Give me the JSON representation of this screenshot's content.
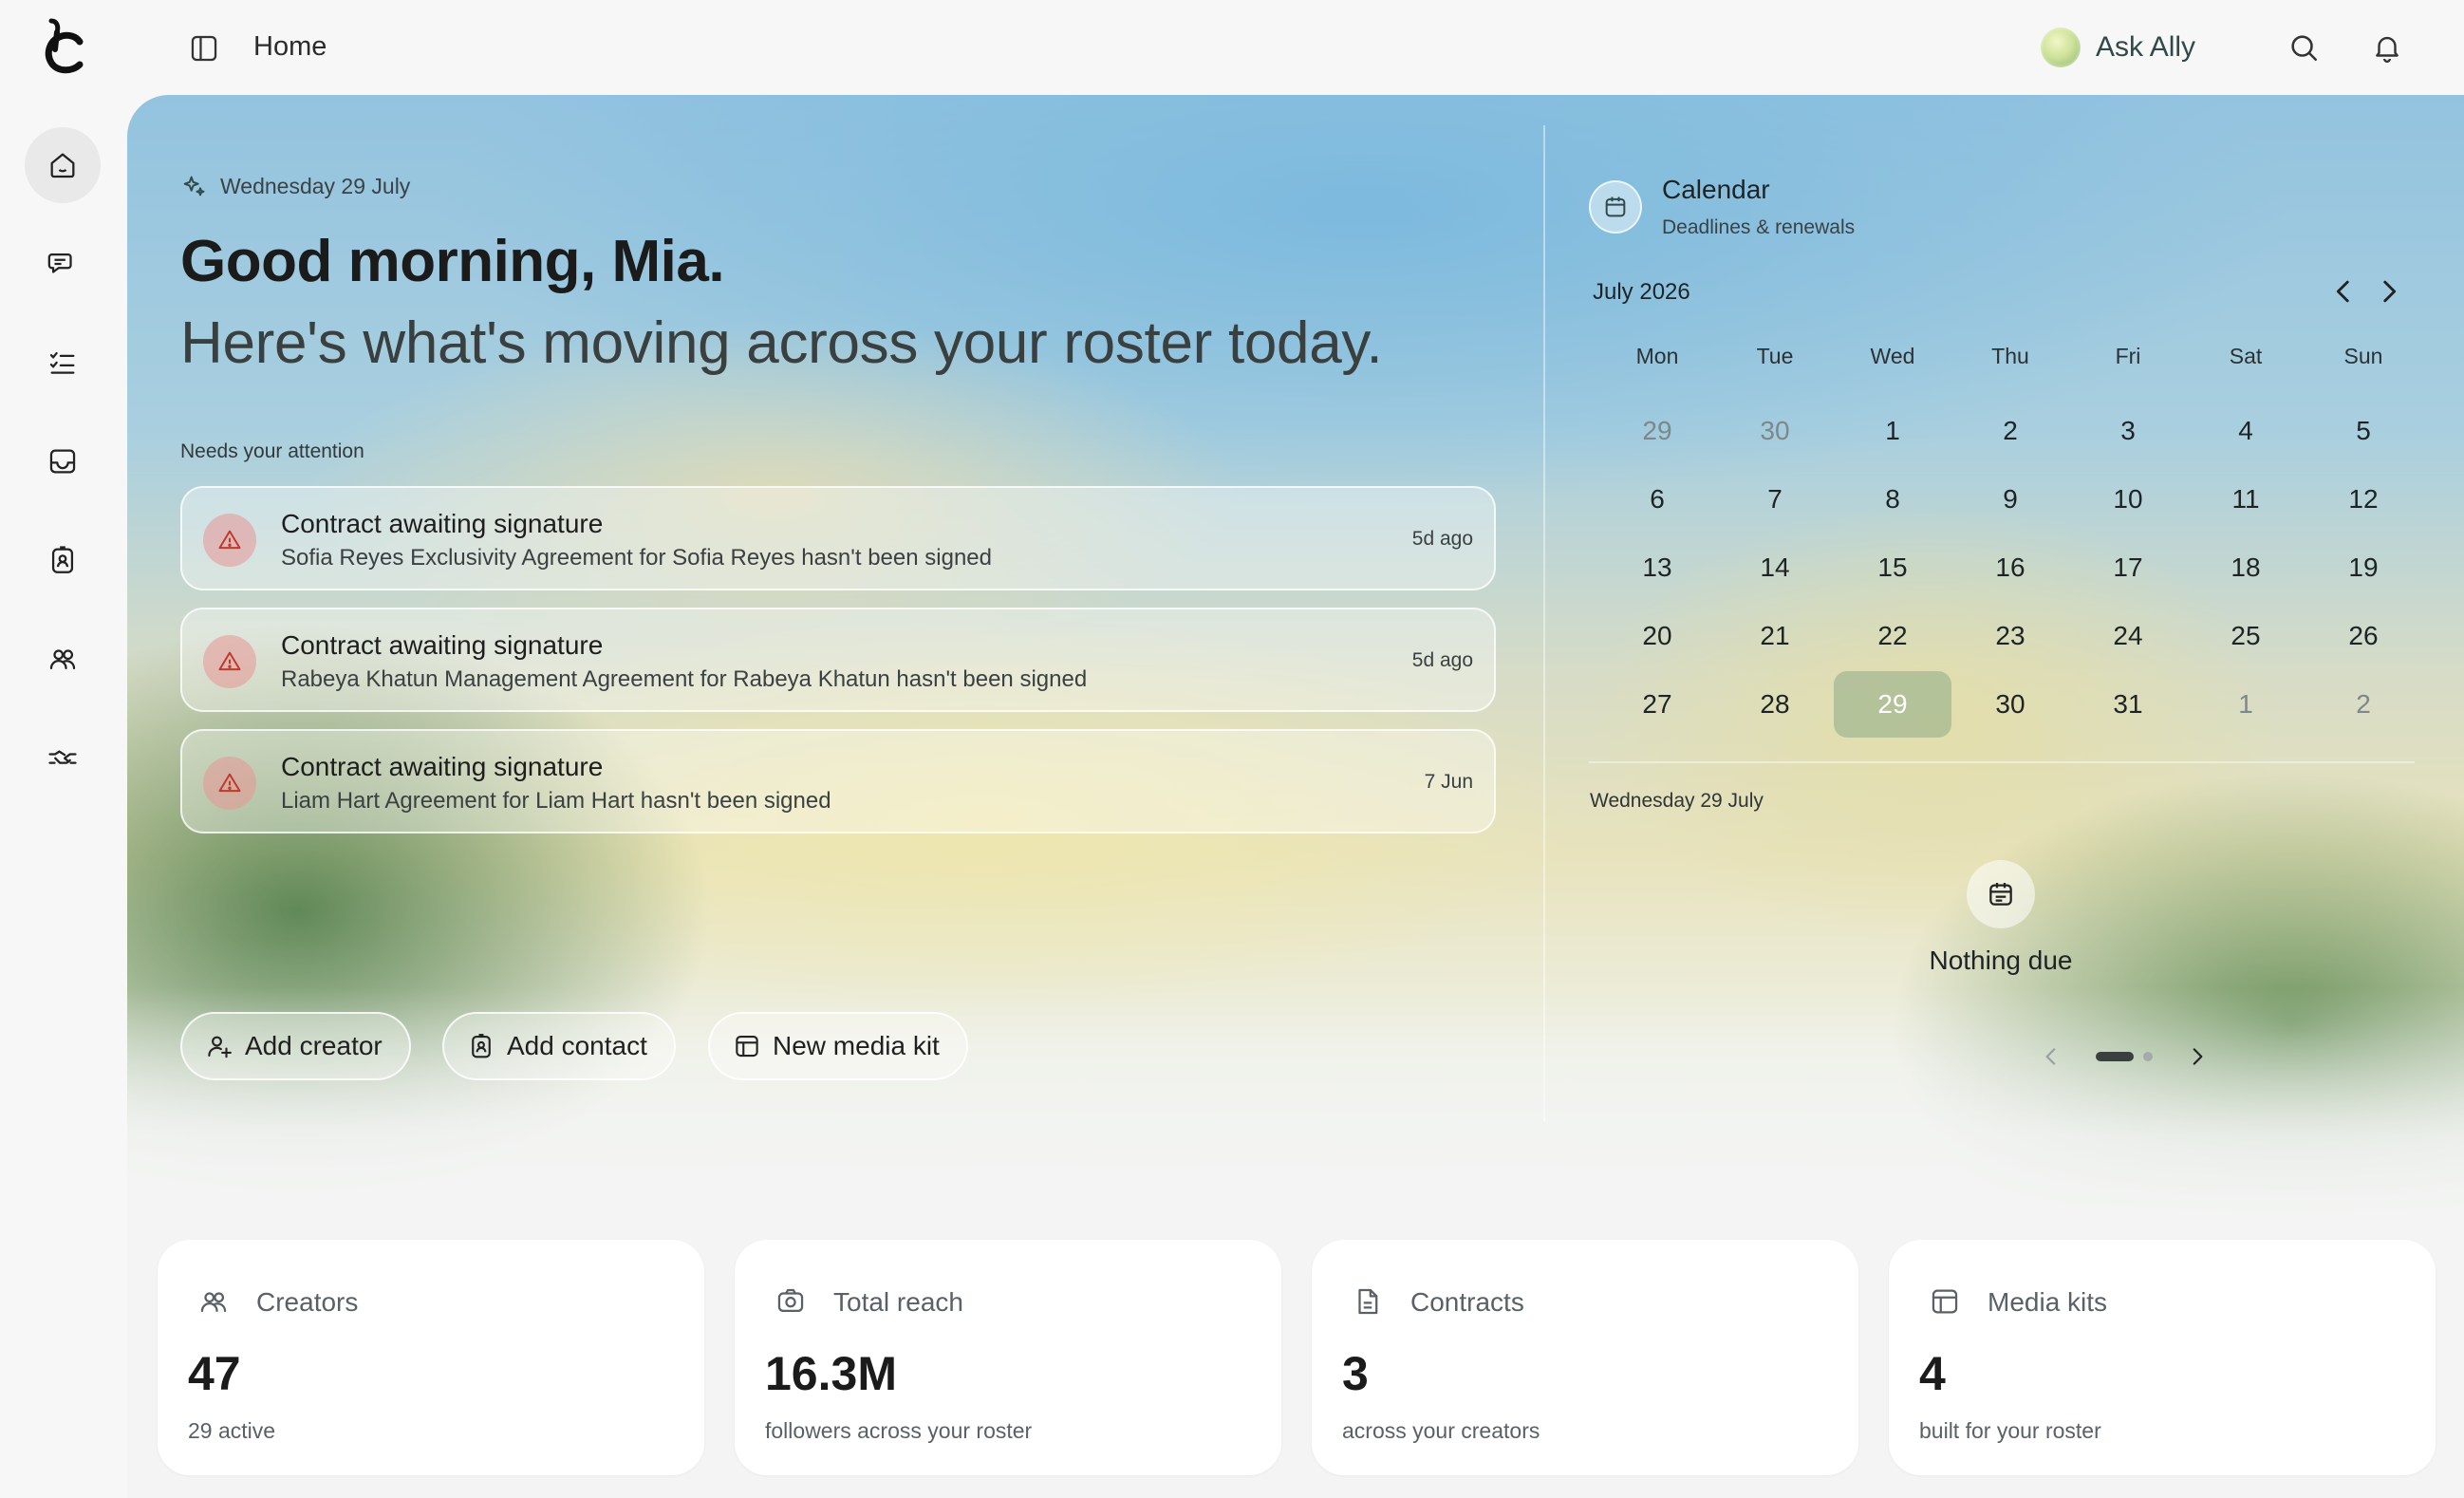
{
  "header": {
    "title": "Home",
    "ask_label": "Ask Ally"
  },
  "greeting": {
    "date": "Wednesday 29 July",
    "headline": "Good morning, Mia.",
    "subline": "Here's what's moving across your roster today."
  },
  "attention": {
    "heading": "Needs your attention",
    "items": [
      {
        "title": "Contract awaiting signature",
        "desc": "Sofia Reyes Exclusivity Agreement for Sofia Reyes hasn't been signed",
        "time": "5d ago"
      },
      {
        "title": "Contract awaiting signature",
        "desc": "Rabeya Khatun Management Agreement for Rabeya Khatun hasn't been signed",
        "time": "5d ago"
      },
      {
        "title": "Contract awaiting signature",
        "desc": "Liam Hart Agreement for Liam Hart hasn't been signed",
        "time": "7 Jun"
      }
    ]
  },
  "actions": {
    "add_creator": "Add creator",
    "add_contact": "Add contact",
    "new_media_kit": "New media kit"
  },
  "calendar": {
    "title": "Calendar",
    "subtitle": "Deadlines & renewals",
    "month": "July 2026",
    "weekdays": [
      "Mon",
      "Tue",
      "Wed",
      "Thu",
      "Fri",
      "Sat",
      "Sun"
    ],
    "days": [
      {
        "d": "29",
        "muted": true
      },
      {
        "d": "30",
        "muted": true
      },
      {
        "d": "1"
      },
      {
        "d": "2"
      },
      {
        "d": "3"
      },
      {
        "d": "4"
      },
      {
        "d": "5"
      },
      {
        "d": "6"
      },
      {
        "d": "7"
      },
      {
        "d": "8"
      },
      {
        "d": "9"
      },
      {
        "d": "10"
      },
      {
        "d": "11"
      },
      {
        "d": "12"
      },
      {
        "d": "13"
      },
      {
        "d": "14"
      },
      {
        "d": "15"
      },
      {
        "d": "16"
      },
      {
        "d": "17"
      },
      {
        "d": "18"
      },
      {
        "d": "19"
      },
      {
        "d": "20"
      },
      {
        "d": "21"
      },
      {
        "d": "22"
      },
      {
        "d": "23"
      },
      {
        "d": "24"
      },
      {
        "d": "25"
      },
      {
        "d": "26"
      },
      {
        "d": "27"
      },
      {
        "d": "28"
      },
      {
        "d": "29",
        "today": true
      },
      {
        "d": "30"
      },
      {
        "d": "31"
      },
      {
        "d": "1",
        "muted": true
      },
      {
        "d": "2",
        "muted": true
      }
    ],
    "selected_date": "Wednesday 29 July",
    "empty_text": "Nothing due",
    "pager": {
      "current": 1,
      "total": 2
    }
  },
  "stats": [
    {
      "icon": "users-icon",
      "label": "Creators",
      "value": "47",
      "sub": "29 active"
    },
    {
      "icon": "camera-icon",
      "label": "Total reach",
      "value": "16.3M",
      "sub": "followers across your roster"
    },
    {
      "icon": "document-icon",
      "label": "Contracts",
      "value": "3",
      "sub": "across your creators"
    },
    {
      "icon": "layout-icon",
      "label": "Media kits",
      "value": "4",
      "sub": "built for your roster"
    }
  ],
  "colors": {
    "alert_badge": "#e89696",
    "today_cell": "#96af8c",
    "accent_text": "#2f4a49"
  }
}
